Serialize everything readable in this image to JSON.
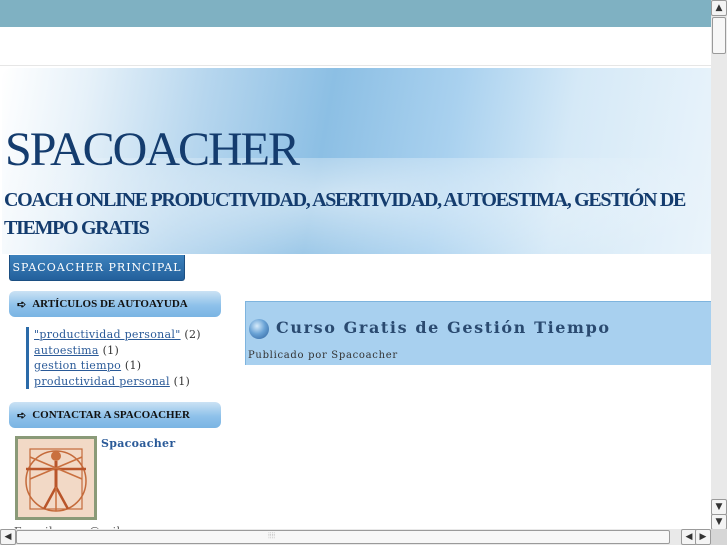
{
  "blog": {
    "title": "SPACOACHER",
    "subtitle": "COACH ONLINE PRODUCTIVIDAD, ASERTIVIDAD, AUTOESTIMA, GESTIÓN DE TIEMPO GRATIS"
  },
  "nav": {
    "tab_label": "SPACOACHER PRINCIPAL"
  },
  "sidebar": {
    "labels_heading": "ARTÍCULOS DE AUTOAYUDA",
    "labels": [
      {
        "name": "\"productividad personal\"",
        "count": "(2)"
      },
      {
        "name": "autoestima",
        "count": "(1)"
      },
      {
        "name": "gestion tiempo",
        "count": "(1)"
      },
      {
        "name": "productividad personal",
        "count": "(1)"
      }
    ],
    "contact_heading": "CONTACTAR A SPACOACHER",
    "profile_name": "Spacoacher",
    "email_partial": "E-mail: ...     ...@...il.co..."
  },
  "post": {
    "title": "Curso Gratis de Gestión Tiempo",
    "meta": "Publicado por Spacoacher"
  },
  "icons": {
    "arrow": "hand-arrow-right-icon",
    "bullet": "blue-orb-icon"
  },
  "colors": {
    "topbar": "#7fb1c2",
    "title": "#143c6e",
    "nav_tab": "#2a6aa8",
    "post_bg": "#a8d0ef"
  }
}
